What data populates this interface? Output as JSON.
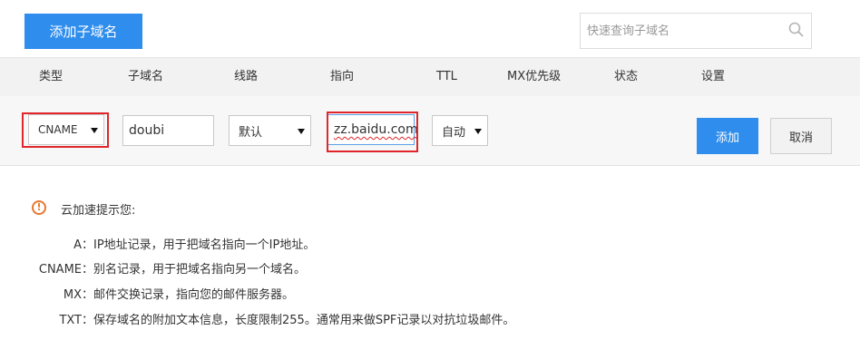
{
  "top": {
    "add_subdomain_label": "添加子域名",
    "search_placeholder": "快速查询子域名"
  },
  "table": {
    "headers": [
      "类型",
      "子域名",
      "线路",
      "指向",
      "TTL",
      "MX优先级",
      "状态",
      "设置"
    ]
  },
  "edit_row": {
    "type_value": "CNAME",
    "subdomain_value": "doubi",
    "line_value": "默认",
    "target_value": "zz.baidu.com",
    "ttl_value": "自动",
    "add_label": "添加",
    "cancel_label": "取消"
  },
  "tips": {
    "icon_glyph": "!",
    "title": "云加速提示您:",
    "items": [
      {
        "key": "A",
        "desc": "：IP地址记录，用于把域名指向一个IP地址。"
      },
      {
        "key": "CNAME",
        "desc": "：别名记录，用于把域名指向另一个域名。"
      },
      {
        "key": "MX",
        "desc": "：邮件交换记录，指向您的邮件服务器。"
      },
      {
        "key": "TXT",
        "desc": "：保存域名的附加文本信息，长度限制255。通常用来做SPF记录以对抗垃圾邮件。"
      }
    ]
  },
  "colors": {
    "primary": "#2e8ded",
    "highlight_frame": "#e0262a",
    "warning": "#e8772e"
  }
}
